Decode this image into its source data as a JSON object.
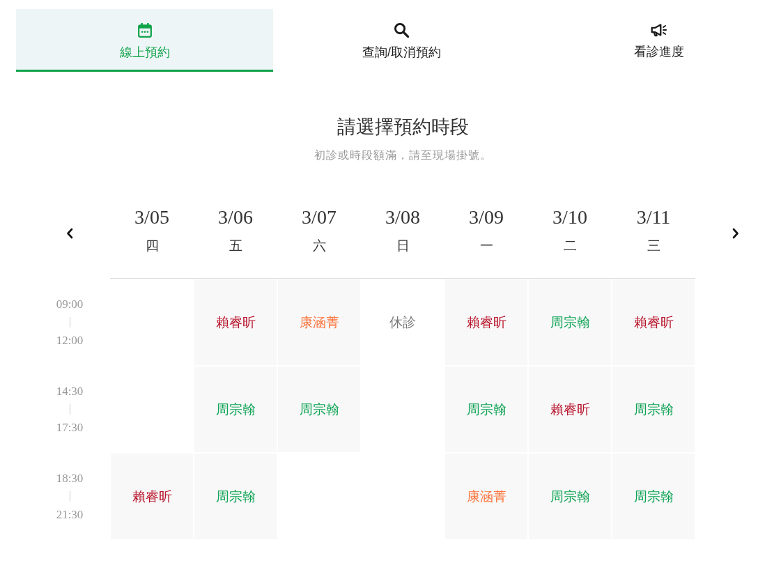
{
  "tabs": [
    {
      "label": "線上預約",
      "selected": true
    },
    {
      "label": "查詢/取消預約",
      "selected": false
    },
    {
      "label": "看診進度",
      "selected": false
    }
  ],
  "heading": {
    "title": "請選擇預約時段",
    "subtitle": "初診或時段額滿，請至現場掛號。"
  },
  "schedule": {
    "days": [
      {
        "date": "3/05",
        "weekday": "四"
      },
      {
        "date": "3/06",
        "weekday": "五"
      },
      {
        "date": "3/07",
        "weekday": "六"
      },
      {
        "date": "3/08",
        "weekday": "日"
      },
      {
        "date": "3/09",
        "weekday": "一"
      },
      {
        "date": "3/10",
        "weekday": "二"
      },
      {
        "date": "3/11",
        "weekday": "三"
      }
    ],
    "slots": [
      {
        "start": "09:00",
        "end": "12:00",
        "cells": [
          {
            "kind": "empty"
          },
          {
            "kind": "doctor",
            "doctor": "賴睿昕",
            "color": "#b8152d"
          },
          {
            "kind": "doctor",
            "doctor": "康涵菁",
            "color": "#fb733a"
          },
          {
            "kind": "closed",
            "label": "休診"
          },
          {
            "kind": "doctor",
            "doctor": "賴睿昕",
            "color": "#b8152d"
          },
          {
            "kind": "doctor",
            "doctor": "周宗翰",
            "color": "#0ea354"
          },
          {
            "kind": "doctor",
            "doctor": "賴睿昕",
            "color": "#b8152d"
          }
        ]
      },
      {
        "start": "14:30",
        "end": "17:30",
        "cells": [
          {
            "kind": "empty"
          },
          {
            "kind": "doctor",
            "doctor": "周宗翰",
            "color": "#0ea354"
          },
          {
            "kind": "doctor",
            "doctor": "周宗翰",
            "color": "#0ea354"
          },
          {
            "kind": "empty"
          },
          {
            "kind": "doctor",
            "doctor": "周宗翰",
            "color": "#0ea354"
          },
          {
            "kind": "doctor",
            "doctor": "賴睿昕",
            "color": "#b8152d"
          },
          {
            "kind": "doctor",
            "doctor": "周宗翰",
            "color": "#0ea354"
          }
        ]
      },
      {
        "start": "18:30",
        "end": "21:30",
        "cells": [
          {
            "kind": "doctor",
            "doctor": "賴睿昕",
            "color": "#b8152d"
          },
          {
            "kind": "doctor",
            "doctor": "周宗翰",
            "color": "#0ea354"
          },
          {
            "kind": "empty"
          },
          {
            "kind": "empty"
          },
          {
            "kind": "doctor",
            "doctor": "康涵菁",
            "color": "#fb733a"
          },
          {
            "kind": "doctor",
            "doctor": "周宗翰",
            "color": "#0ea354"
          },
          {
            "kind": "doctor",
            "doctor": "周宗翰",
            "color": "#0ea354"
          }
        ]
      }
    ]
  }
}
